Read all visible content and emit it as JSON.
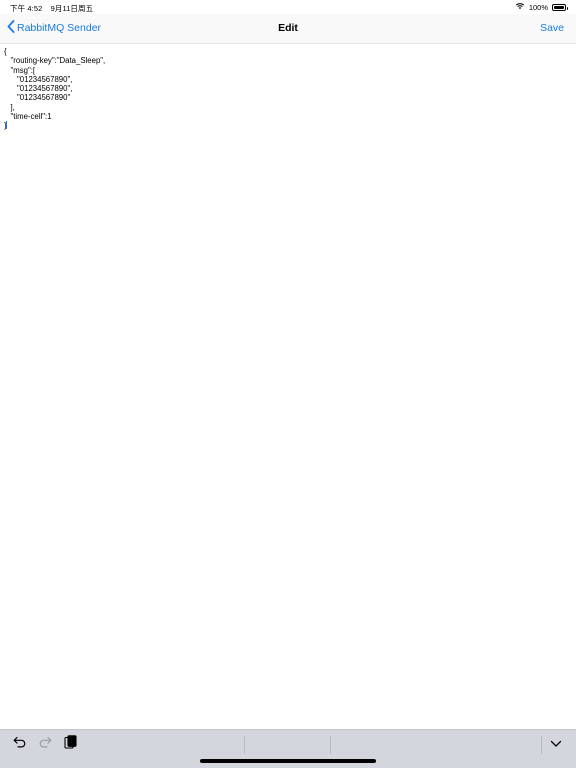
{
  "status_bar": {
    "left_text": "下午 4:52",
    "date": "9月11日周五",
    "battery_percent": "100%",
    "battery_level": 1.0,
    "icons": [
      "wifi-icon",
      "battery-icon"
    ]
  },
  "nav": {
    "back_label": "RabbitMQ Sender",
    "title": "Edit",
    "save_label": "Save",
    "accent_color": "#1a7ce0"
  },
  "editor": {
    "content": "{\n   \"routing-key\":\"Data_Sleep\",\n   \"msg\":[\n      \"01234567890\",\n      \"01234567890\",\n      \"01234567890\"\n   ],\n   \"time-cell\":1\n}"
  },
  "toolbar": {
    "icons": [
      "undo-icon",
      "redo-icon",
      "paste-icon",
      "dismiss-keyboard-icon"
    ],
    "redo_enabled": false
  }
}
